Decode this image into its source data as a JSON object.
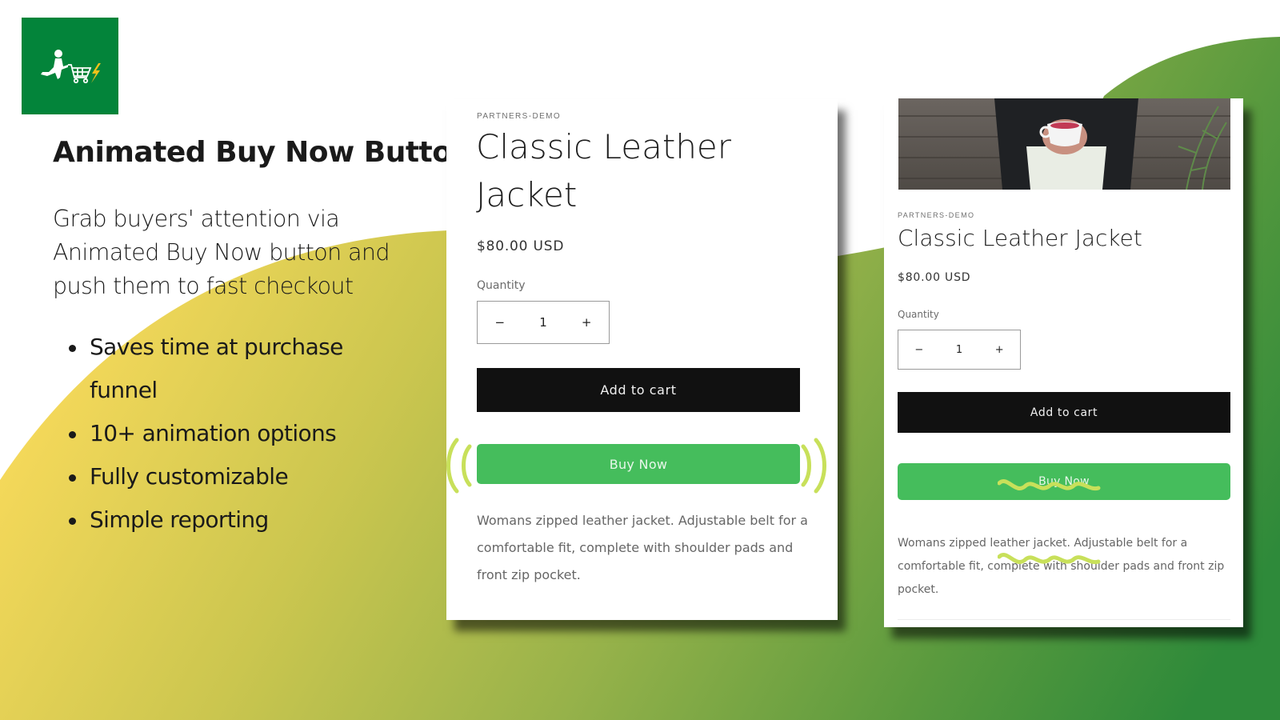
{
  "colors": {
    "brand_green": "#03843a",
    "buy_now_green": "#45bd5c",
    "animation_accent": "#c8e05a",
    "add_to_cart_black": "#111111",
    "gradient_start_yellow": "#fddc5c",
    "gradient_end_green": "#2e8a3a"
  },
  "logo": {
    "icon": "running-shopper-cart-lightning-icon"
  },
  "hero": {
    "title": "Animated Buy Now Button",
    "intro": "Grab buyers' attention via Animated Buy Now button and push them to fast checkout",
    "features": [
      "Saves time at purchase funnel",
      "10+ animation options",
      "Fully customizable",
      "Simple reporting"
    ]
  },
  "product_cards": [
    {
      "vendor": "PARTNERS-DEMO",
      "title": "Classic Leather Jacket",
      "price": "$80.00 USD",
      "quantity_label": "Quantity",
      "quantity_value": "1",
      "decrement_symbol": "−",
      "increment_symbol": "+",
      "add_to_cart_label": "Add to cart",
      "buy_now_label": "Buy Now",
      "animation": "pulse-waves",
      "description": "Womans zipped leather jacket. Adjustable belt for a comfortable fit, complete with shoulder pads and front zip pocket."
    },
    {
      "image_alt": "Person in leather jacket holding a cup of tea",
      "vendor": "PARTNERS-DEMO",
      "title": "Classic Leather Jacket",
      "price": "$80.00 USD",
      "quantity_label": "Quantity",
      "quantity_value": "1",
      "decrement_symbol": "−",
      "increment_symbol": "+",
      "add_to_cart_label": "Add to cart",
      "buy_now_label": "Buy Now",
      "animation": "squiggle-wave",
      "description": "Womans zipped leather jacket. Adjustable belt for a comfortable fit, complete with shoulder pads and front zip pocket."
    }
  ]
}
